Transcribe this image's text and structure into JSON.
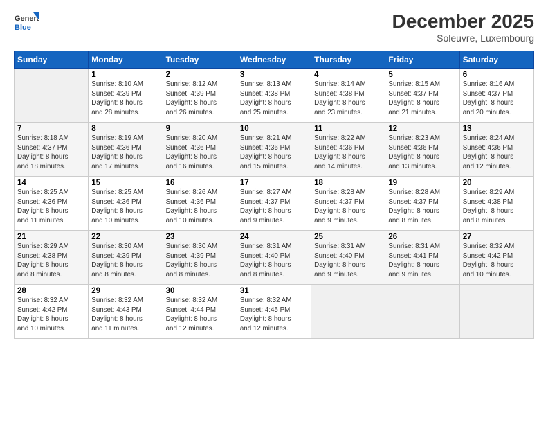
{
  "header": {
    "logo_line1": "General",
    "logo_line2": "Blue",
    "month": "December 2025",
    "location": "Soleuvre, Luxembourg"
  },
  "days_of_week": [
    "Sunday",
    "Monday",
    "Tuesday",
    "Wednesday",
    "Thursday",
    "Friday",
    "Saturday"
  ],
  "weeks": [
    [
      {
        "date": "",
        "info": ""
      },
      {
        "date": "1",
        "info": "Sunrise: 8:10 AM\nSunset: 4:39 PM\nDaylight: 8 hours\nand 28 minutes."
      },
      {
        "date": "2",
        "info": "Sunrise: 8:12 AM\nSunset: 4:39 PM\nDaylight: 8 hours\nand 26 minutes."
      },
      {
        "date": "3",
        "info": "Sunrise: 8:13 AM\nSunset: 4:38 PM\nDaylight: 8 hours\nand 25 minutes."
      },
      {
        "date": "4",
        "info": "Sunrise: 8:14 AM\nSunset: 4:38 PM\nDaylight: 8 hours\nand 23 minutes."
      },
      {
        "date": "5",
        "info": "Sunrise: 8:15 AM\nSunset: 4:37 PM\nDaylight: 8 hours\nand 21 minutes."
      },
      {
        "date": "6",
        "info": "Sunrise: 8:16 AM\nSunset: 4:37 PM\nDaylight: 8 hours\nand 20 minutes."
      }
    ],
    [
      {
        "date": "7",
        "info": "Sunrise: 8:18 AM\nSunset: 4:37 PM\nDaylight: 8 hours\nand 18 minutes."
      },
      {
        "date": "8",
        "info": "Sunrise: 8:19 AM\nSunset: 4:36 PM\nDaylight: 8 hours\nand 17 minutes."
      },
      {
        "date": "9",
        "info": "Sunrise: 8:20 AM\nSunset: 4:36 PM\nDaylight: 8 hours\nand 16 minutes."
      },
      {
        "date": "10",
        "info": "Sunrise: 8:21 AM\nSunset: 4:36 PM\nDaylight: 8 hours\nand 15 minutes."
      },
      {
        "date": "11",
        "info": "Sunrise: 8:22 AM\nSunset: 4:36 PM\nDaylight: 8 hours\nand 14 minutes."
      },
      {
        "date": "12",
        "info": "Sunrise: 8:23 AM\nSunset: 4:36 PM\nDaylight: 8 hours\nand 13 minutes."
      },
      {
        "date": "13",
        "info": "Sunrise: 8:24 AM\nSunset: 4:36 PM\nDaylight: 8 hours\nand 12 minutes."
      }
    ],
    [
      {
        "date": "14",
        "info": "Sunrise: 8:25 AM\nSunset: 4:36 PM\nDaylight: 8 hours\nand 11 minutes."
      },
      {
        "date": "15",
        "info": "Sunrise: 8:25 AM\nSunset: 4:36 PM\nDaylight: 8 hours\nand 10 minutes."
      },
      {
        "date": "16",
        "info": "Sunrise: 8:26 AM\nSunset: 4:36 PM\nDaylight: 8 hours\nand 10 minutes."
      },
      {
        "date": "17",
        "info": "Sunrise: 8:27 AM\nSunset: 4:37 PM\nDaylight: 8 hours\nand 9 minutes."
      },
      {
        "date": "18",
        "info": "Sunrise: 8:28 AM\nSunset: 4:37 PM\nDaylight: 8 hours\nand 9 minutes."
      },
      {
        "date": "19",
        "info": "Sunrise: 8:28 AM\nSunset: 4:37 PM\nDaylight: 8 hours\nand 8 minutes."
      },
      {
        "date": "20",
        "info": "Sunrise: 8:29 AM\nSunset: 4:38 PM\nDaylight: 8 hours\nand 8 minutes."
      }
    ],
    [
      {
        "date": "21",
        "info": "Sunrise: 8:29 AM\nSunset: 4:38 PM\nDaylight: 8 hours\nand 8 minutes."
      },
      {
        "date": "22",
        "info": "Sunrise: 8:30 AM\nSunset: 4:39 PM\nDaylight: 8 hours\nand 8 minutes."
      },
      {
        "date": "23",
        "info": "Sunrise: 8:30 AM\nSunset: 4:39 PM\nDaylight: 8 hours\nand 8 minutes."
      },
      {
        "date": "24",
        "info": "Sunrise: 8:31 AM\nSunset: 4:40 PM\nDaylight: 8 hours\nand 8 minutes."
      },
      {
        "date": "25",
        "info": "Sunrise: 8:31 AM\nSunset: 4:40 PM\nDaylight: 8 hours\nand 9 minutes."
      },
      {
        "date": "26",
        "info": "Sunrise: 8:31 AM\nSunset: 4:41 PM\nDaylight: 8 hours\nand 9 minutes."
      },
      {
        "date": "27",
        "info": "Sunrise: 8:32 AM\nSunset: 4:42 PM\nDaylight: 8 hours\nand 10 minutes."
      }
    ],
    [
      {
        "date": "28",
        "info": "Sunrise: 8:32 AM\nSunset: 4:42 PM\nDaylight: 8 hours\nand 10 minutes."
      },
      {
        "date": "29",
        "info": "Sunrise: 8:32 AM\nSunset: 4:43 PM\nDaylight: 8 hours\nand 11 minutes."
      },
      {
        "date": "30",
        "info": "Sunrise: 8:32 AM\nSunset: 4:44 PM\nDaylight: 8 hours\nand 12 minutes."
      },
      {
        "date": "31",
        "info": "Sunrise: 8:32 AM\nSunset: 4:45 PM\nDaylight: 8 hours\nand 12 minutes."
      },
      {
        "date": "",
        "info": ""
      },
      {
        "date": "",
        "info": ""
      },
      {
        "date": "",
        "info": ""
      }
    ]
  ]
}
